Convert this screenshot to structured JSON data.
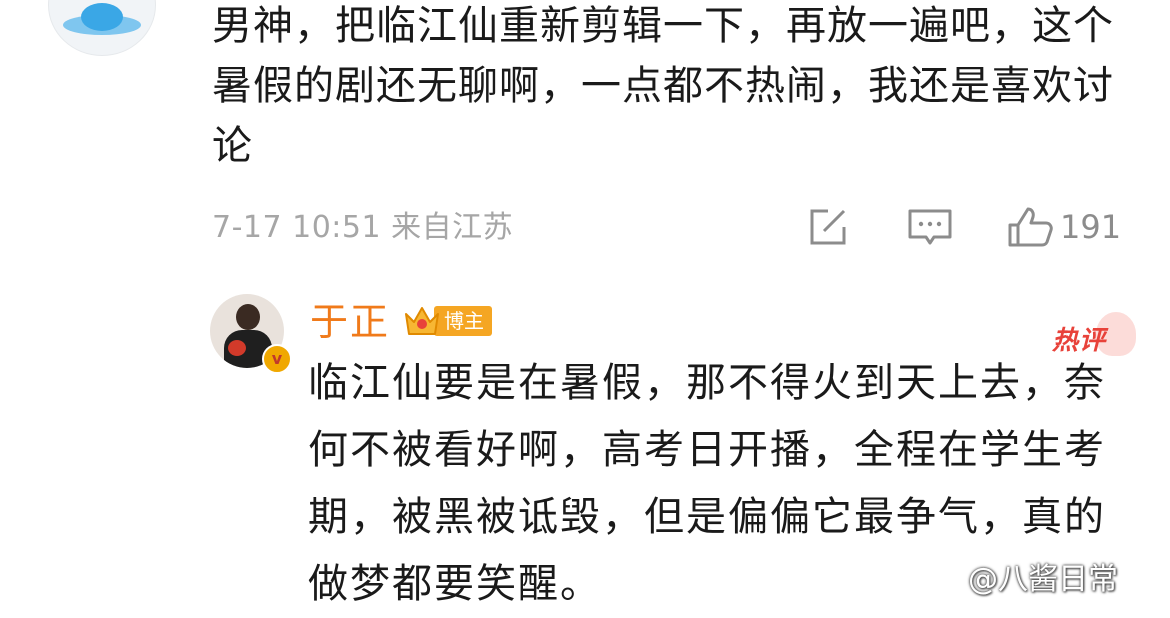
{
  "top_comment": {
    "text": "男神，把临江仙重新剪辑一下，再放一遍吧，这个暑假的剧还无聊啊，一点都不热闹，我还是喜欢讨论",
    "timestamp_location": "7-17 10:51 来自江苏",
    "like_count": "191",
    "icons": [
      "edit-icon",
      "comment-icon",
      "thumbs-up-icon"
    ]
  },
  "reply": {
    "username": "于正",
    "badge": "博主",
    "verified_mark": "v",
    "hot_label": "热评",
    "text": "临江仙要是在暑假，那不得火到天上去，奈何不被看好啊，高考日开播，全程在学生考期，被黑被诋毁，但是偏偏它最争气，真的做梦都要笑醒。"
  },
  "watermark": {
    "text": "@八酱日常"
  },
  "colors": {
    "username": "#f07a1a",
    "badge_bg": "#f5a623",
    "hot": "#e8423a",
    "meta": "#a6a6a6"
  }
}
